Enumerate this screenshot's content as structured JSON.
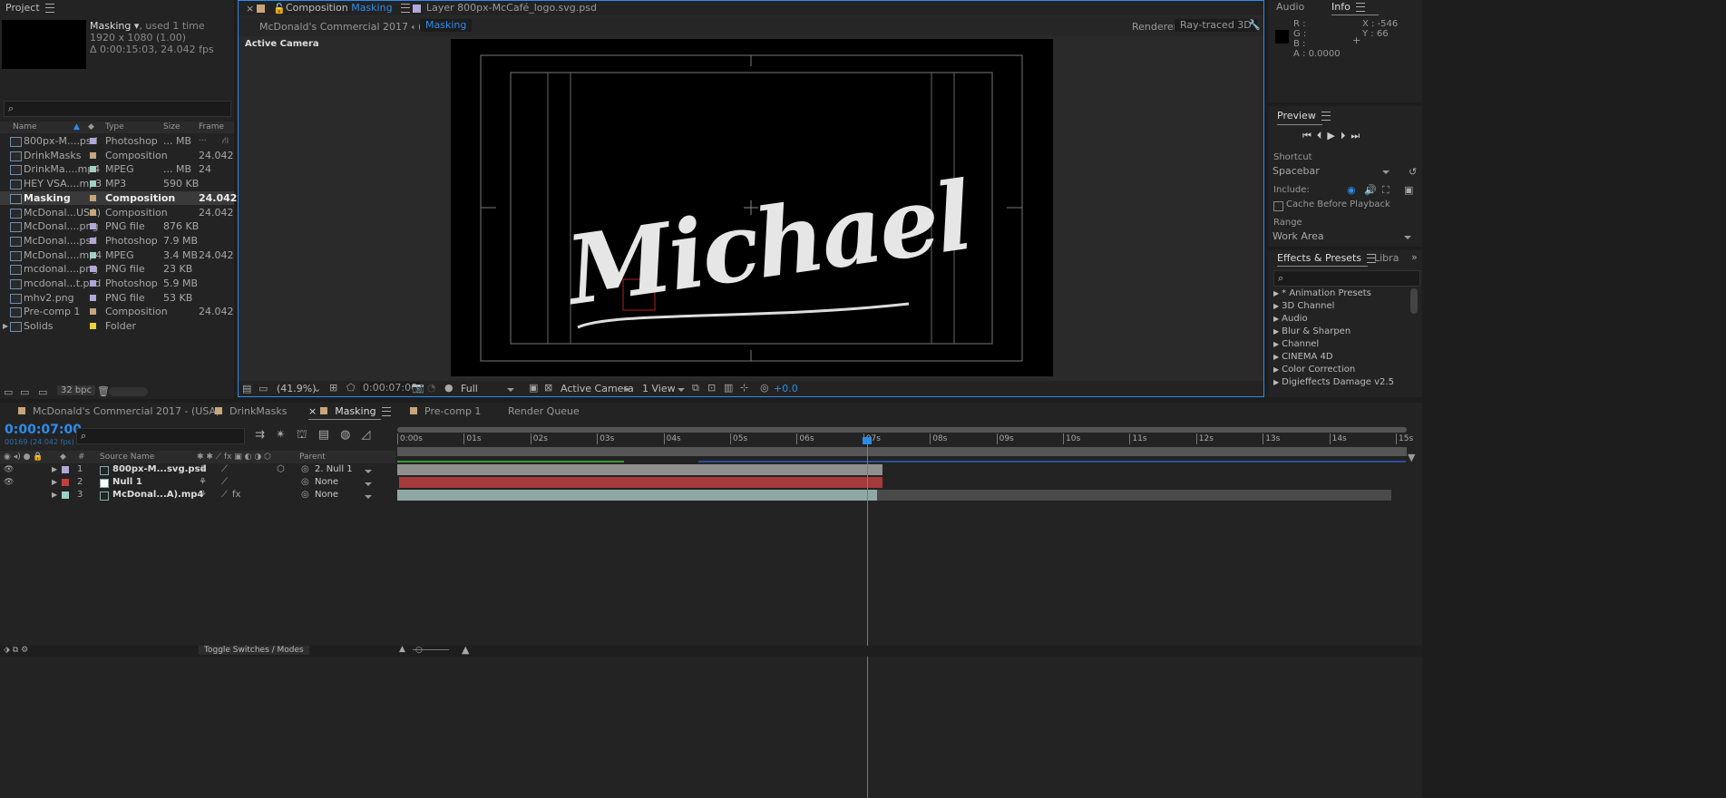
{
  "project": {
    "title": "Project",
    "comp_name": "Masking",
    "used": ", used 1 time",
    "resolution": "1920 x 1080 (1.00)",
    "duration": "Δ 0:00:15:03, 24.042 fps",
    "columns": [
      "Name",
      "Type",
      "Size",
      "Frame ..."
    ],
    "items": [
      {
        "name": "800px-M....psd",
        "type": "Photoshop",
        "size": "... MB",
        "fps": "",
        "color": "#b0a8d8"
      },
      {
        "name": "DrinkMasks",
        "type": "Composition",
        "size": "",
        "fps": "24.042",
        "color": "#c8a57a"
      },
      {
        "name": "DrinkMa....mp4",
        "type": "MPEG",
        "size": "... MB",
        "fps": "24",
        "color": "#9fd0c4"
      },
      {
        "name": "HEY VSA....mp3",
        "type": "MP3",
        "size": "590 KB",
        "fps": "",
        "color": "#9fd0c4"
      },
      {
        "name": "Masking",
        "type": "Composition",
        "size": "",
        "fps": "24.042",
        "color": "#c8a57a"
      },
      {
        "name": "McDonal...USA)",
        "type": "Composition",
        "size": "",
        "fps": "24.042",
        "color": "#c8a57a"
      },
      {
        "name": "McDonal....png",
        "type": "PNG file",
        "size": "876 KB",
        "fps": "",
        "color": "#b0a8d8"
      },
      {
        "name": "McDonal....psd",
        "type": "Photoshop",
        "size": "7.9 MB",
        "fps": "",
        "color": "#b0a8d8"
      },
      {
        "name": "McDonal....mp4",
        "type": "MPEG",
        "size": "3.4 MB",
        "fps": "24.042",
        "color": "#9fd0c4"
      },
      {
        "name": "mcdonal....png",
        "type": "PNG file",
        "size": "23 KB",
        "fps": "",
        "color": "#b0a8d8"
      },
      {
        "name": "mcdonal...t.psd",
        "type": "Photoshop",
        "size": "5.9 MB",
        "fps": "",
        "color": "#b0a8d8"
      },
      {
        "name": "mhv2.png",
        "type": "PNG file",
        "size": "53 KB",
        "fps": "",
        "color": "#b0a8d8"
      },
      {
        "name": "Pre-comp 1",
        "type": "Composition",
        "size": "",
        "fps": "24.042",
        "color": "#c8a57a"
      },
      {
        "name": "Solids",
        "type": "Folder",
        "size": "",
        "fps": "",
        "color": "#e5d33a"
      }
    ],
    "bpc": "32 bpc"
  },
  "comp_viewer": {
    "tab_comp": "Composition",
    "tab_comp_name": "Masking",
    "tab_layer": "Layer 800px-McCafé_logo.svg.psd",
    "breadcrumb_parent": "McDonald's Commercial 2017 - (USA)",
    "breadcrumb_current": "Masking",
    "renderer_label": "Renderer:",
    "renderer_value": "Ray-traced 3D",
    "camera_label": "Active Camera",
    "canvas_text": "Michael",
    "zoom": "(41.9%)",
    "timecode": "0:00:07:00",
    "resolution": "Full",
    "view_camera": "Active Camera",
    "views": "1 View",
    "exposure": "+0.0"
  },
  "info": {
    "tab_audio": "Audio",
    "tab_info": "Info",
    "r": "R :",
    "g": "G :",
    "b": "B :",
    "a": "A : 0.0000",
    "x": "X : -546",
    "y": "Y : 66"
  },
  "preview": {
    "title": "Preview",
    "shortcut_label": "Shortcut",
    "shortcut_value": "Spacebar",
    "include_label": "Include:",
    "cache_label": "Cache Before Playback",
    "range_label": "Range",
    "range_value": "Work Area"
  },
  "effects": {
    "title": "Effects & Presets",
    "tab_libraries": "Libra",
    "items": [
      "* Animation Presets",
      "3D Channel",
      "Audio",
      "Blur & Sharpen",
      "Channel",
      "CINEMA 4D",
      "Color Correction",
      "Digieffects Damage v2.5"
    ]
  },
  "timeline": {
    "tabs": [
      "McDonald's Commercial 2017 - (USA)",
      "DrinkMasks",
      "Masking",
      "Pre-comp 1",
      "Render Queue"
    ],
    "timecode": "0:00:07:00",
    "frames": "00169 (24.042 fps)",
    "col_source": "Source Name",
    "col_parent": "Parent",
    "col_num": "#",
    "ruler": [
      "0:00s",
      "01s",
      "02s",
      "03s",
      "04s",
      "05s",
      "06s",
      "07s",
      "08s",
      "09s",
      "10s",
      "11s",
      "12s",
      "13s",
      "14s",
      "15s"
    ],
    "layers": [
      {
        "num": "1",
        "name": "800px-M...svg.psd",
        "parent": "2. Null 1",
        "color": "#b0a8d8"
      },
      {
        "num": "2",
        "name": "Null 1",
        "parent": "None",
        "color": "#c04040"
      },
      {
        "num": "3",
        "name": "McDonal...A).mp4",
        "parent": "None",
        "color": "#9fd0c4"
      }
    ],
    "toggle_label": "Toggle Switches / Modes"
  }
}
